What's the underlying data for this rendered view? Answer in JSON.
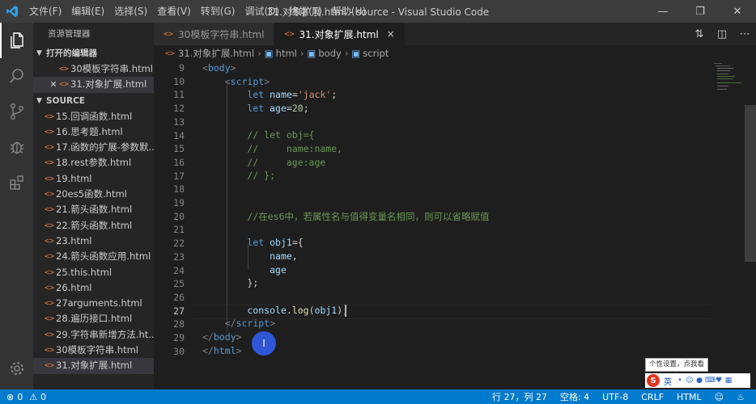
{
  "window": {
    "title": "31.对象扩展.html - source - Visual Studio Code",
    "menu": [
      "文件(F)",
      "编辑(E)",
      "选择(S)",
      "查看(V)",
      "转到(G)",
      "调试(D)",
      "终端(T)",
      "帮助(H)"
    ]
  },
  "sidebar": {
    "header": "资源管理器",
    "open_editors_label": "打开的编辑器",
    "open_editors": [
      {
        "name": "30模板字符串.html"
      },
      {
        "name": "31.对象扩展.html"
      }
    ],
    "source_label": "SOURCE",
    "files": [
      "15.回调函数.html",
      "16.思考题.html",
      "17.函数的扩展-参数默...",
      "18.rest参数.html",
      "19.html",
      "20es5函数.html",
      "21.箭头函数.html",
      "22.箭头函数.html",
      "23.html",
      "24.箭头函数应用.html",
      "25.this.html",
      "26.html",
      "27arguments.html",
      "28.遍历接口.html",
      "29.字符串新增方法.ht...",
      "30模板字符串.html",
      "31.对象扩展.html"
    ]
  },
  "tabs": [
    {
      "label": "30模板字符串.html"
    },
    {
      "label": "31.对象扩展.html",
      "close": "×"
    }
  ],
  "breadcrumb": [
    "31.对象扩展.html",
    "html",
    "body",
    "script"
  ],
  "editor": {
    "line_numbers": [
      "9",
      "10",
      "11",
      "12",
      "13",
      "14",
      "15",
      "16",
      "17",
      "18",
      "19",
      "20",
      "21",
      "22",
      "23",
      "24",
      "25",
      "26",
      "27",
      "28",
      "29",
      "30"
    ],
    "current_line": "27"
  },
  "tooltip": "个性设置，点我看看",
  "ime": {
    "logo": "S",
    "mode": "英"
  },
  "statusbar": {
    "errors": "0",
    "warnings": "0",
    "position": "行 27，列 27",
    "spaces": "空格: 4",
    "encoding": "UTF-8",
    "eol": "CRLF",
    "language": "HTML"
  },
  "colors": {
    "accent": "#007acc",
    "keyword": "#569cd6",
    "string": "#ce9178",
    "comment": "#6a9955",
    "variable": "#9cdcfe",
    "file_icon": "#e37933"
  }
}
